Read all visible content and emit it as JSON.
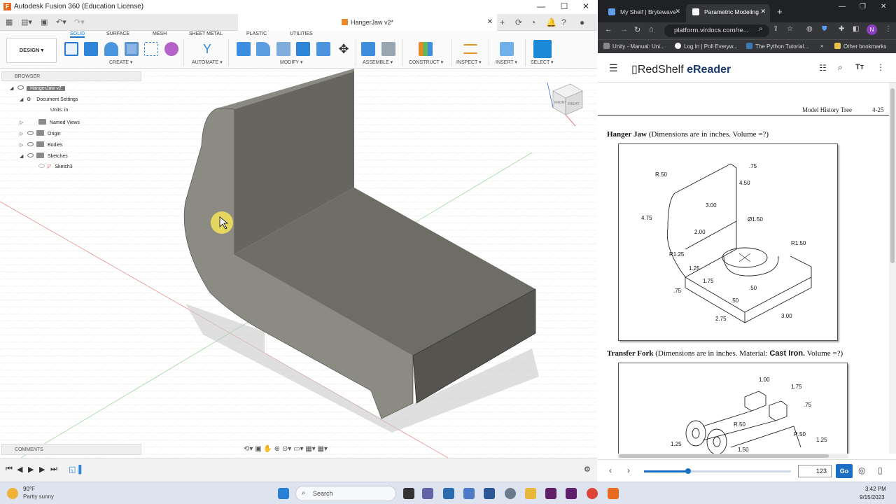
{
  "fusion": {
    "window_title": "Autodesk Fusion 360 (Education License)",
    "doc_tab": "HangerJaw v2*",
    "ribbon_tabs": [
      "SOLID",
      "SURFACE",
      "MESH",
      "SHEET METAL",
      "PLASTIC",
      "UTILITIES"
    ],
    "active_tab": "SOLID",
    "workspace_button": "DESIGN ▾",
    "groups": [
      "CREATE ▾",
      "AUTOMATE ▾",
      "MODIFY ▾",
      "ASSEMBLE ▾",
      "CONSTRUCT ▾",
      "INSPECT ▾",
      "INSERT ▾",
      "SELECT ▾"
    ],
    "browser": {
      "header": "BROWSER",
      "nodes": [
        {
          "label": "HangerJaw v2"
        },
        {
          "label": "Document Settings"
        },
        {
          "label": "Units: in"
        },
        {
          "label": "Named Views"
        },
        {
          "label": "Origin"
        },
        {
          "label": "Bodies"
        },
        {
          "label": "Sketches"
        },
        {
          "label": "Sketch3"
        }
      ]
    },
    "comments_label": "COMMENTS",
    "viewcube": {
      "front": "FRONT",
      "right": "RIGHT"
    },
    "colors": {
      "accent": "#1673c6",
      "model": "#6e6d66"
    }
  },
  "chrome": {
    "tabs": [
      {
        "label": "My Shelf | Brytewave"
      },
      {
        "label": "Parametric Modeling"
      }
    ],
    "url": "platform.virdocs.com/re...",
    "bookmarks": [
      "Unity - Manual: Uni...",
      "Log In | Poll Everyw...",
      "The Python Tutorial...",
      "Other bookmarks"
    ]
  },
  "reader": {
    "logo_a": "RedShelf",
    "logo_b": "eReader",
    "page_header": "Model History Tree",
    "page_number": "4-25",
    "problem1": {
      "title": "Hanger Jaw",
      "desc": "(Dimensions are in inches. Volume =?)"
    },
    "problem2": {
      "title": "Transfer Fork",
      "desc": "(Dimensions are in inches. Material: ",
      "material": "Cast Iron.",
      "tail": " Volume =?)"
    },
    "dims1": [
      "R.50",
      ".75",
      "4.50",
      "3.00",
      "4.75",
      "2.00",
      "Ø1.50",
      "R1.50",
      "R1.25",
      "1.25",
      "1.75",
      ".50",
      ".75",
      ".50",
      "2.75",
      "3.00"
    ],
    "dims2": [
      "1.00",
      "1.75",
      ".75",
      "R.50",
      "1.25",
      "R.50",
      "1.50",
      "1.25"
    ],
    "page_input": "123",
    "go_label": "Go",
    "progress": 0.3
  },
  "taskbar": {
    "temp": "90°F",
    "weather": "Partly sunny",
    "search": "Search",
    "time": "3:42 PM",
    "date": "9/15/2023"
  }
}
